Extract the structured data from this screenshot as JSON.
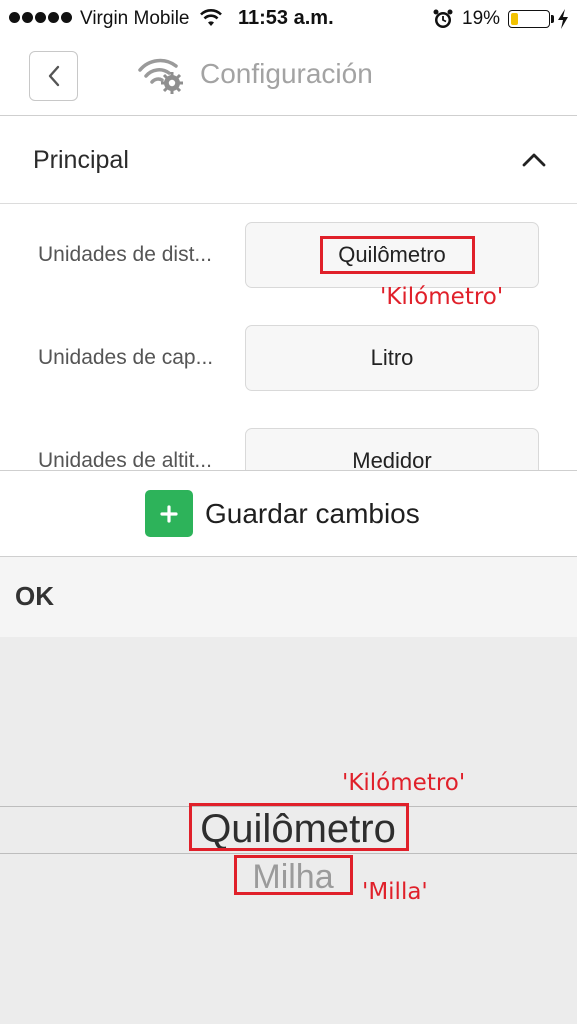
{
  "status_bar": {
    "carrier": "Virgin Mobile",
    "time": "11:53 a.m.",
    "battery_percent": "19%",
    "battery_level": 0.19,
    "battery_color": "#f2c200"
  },
  "header": {
    "back_icon": "chevron-left-icon",
    "app_icon": "wifi-gear-icon",
    "title": "Configuración"
  },
  "section": {
    "title": "Principal",
    "toggle_icon": "chevron-up-icon"
  },
  "settings": [
    {
      "label": "Unidades de dist...",
      "value": "Quilômetro"
    },
    {
      "label": "Unidades de cap...",
      "value": "Litro"
    },
    {
      "label": "Unidades de altit...",
      "value": "Medidor"
    }
  ],
  "save": {
    "label": "Guardar cambios",
    "icon": "plus-icon",
    "color": "#2db35a"
  },
  "picker": {
    "ok_label": "OK",
    "selected": "Quilômetro",
    "next": "Milha"
  },
  "annotations": {
    "field_translation": "'Kilómetro'",
    "picker_selected_translation": "'Kilómetro'",
    "picker_next_translation": "'Milla'",
    "color": "#e0202a"
  }
}
